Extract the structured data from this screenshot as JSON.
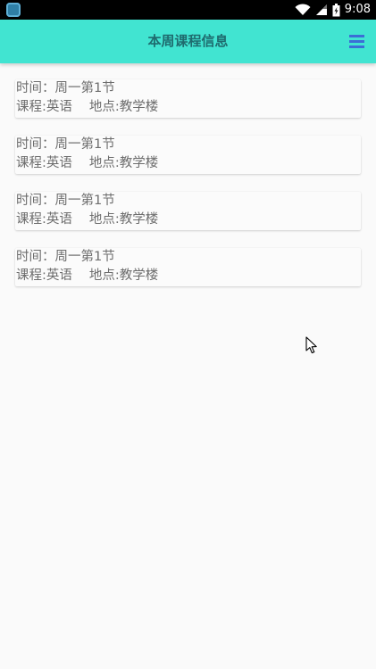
{
  "status_bar": {
    "time": "9:08",
    "icons": [
      "app-notification-icon",
      "wifi-icon",
      "cellular-signal-icon",
      "battery-icon"
    ]
  },
  "header": {
    "title": "本周课程信息",
    "menu_icon": "hamburger-menu-icon"
  },
  "courses": [
    {
      "time_text": "时间：周一第1节",
      "course_text": "课程:英语",
      "location_text": "地点:教学楼"
    },
    {
      "time_text": "时间：周一第1节",
      "course_text": "课程:英语",
      "location_text": "地点:教学楼"
    },
    {
      "time_text": "时间：周一第1节",
      "course_text": "课程:英语",
      "location_text": "地点:教学楼"
    },
    {
      "time_text": "时间：周一第1节",
      "course_text": "课程:英语",
      "location_text": "地点:教学楼"
    }
  ],
  "colors": {
    "app_bar": "#41e4d1",
    "title_text": "#1f6b6e",
    "menu_icon": "#3b6ed6",
    "background": "#fafafa",
    "card_text": "#6d6d6d"
  }
}
